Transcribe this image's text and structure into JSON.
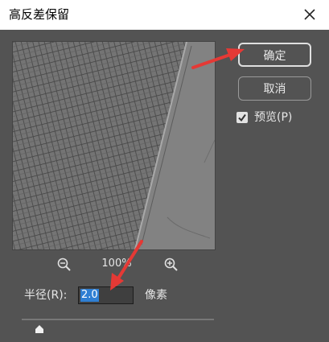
{
  "dialog": {
    "title": "高反差保留",
    "close_label": "×"
  },
  "buttons": {
    "ok": "确定",
    "cancel": "取消"
  },
  "preview": {
    "checkbox_label": "预览(P)",
    "checked": true
  },
  "zoom": {
    "level": "100%"
  },
  "radius": {
    "label": "半径(R):",
    "value": "2.0",
    "unit": "像素"
  },
  "slider": {
    "fraction": 0.09
  },
  "colors": {
    "dialog_bg": "#535353",
    "selection": "#2f7fd3",
    "annotation_arrow": "#e53935"
  },
  "icons": [
    "close-icon",
    "zoom-out-icon",
    "zoom-in-icon",
    "checkmark-icon",
    "slider-thumb-icon",
    "annotation-arrow-icon"
  ]
}
